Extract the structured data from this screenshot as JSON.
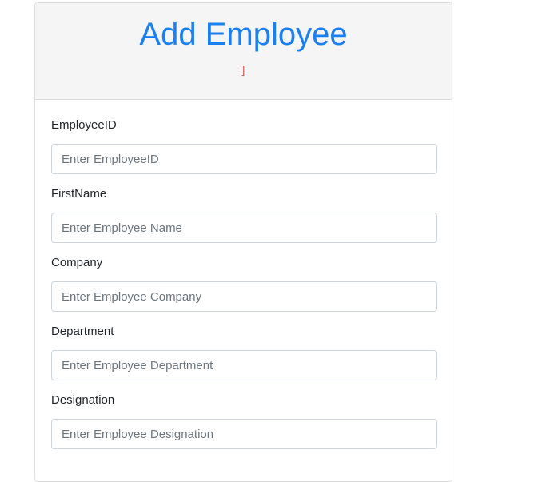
{
  "header": {
    "title": "Add Employee",
    "error_text": "]"
  },
  "form": {
    "fields": [
      {
        "label": "EmployeeID",
        "placeholder": "Enter EmployeeID",
        "value": ""
      },
      {
        "label": "FirstName",
        "placeholder": "Enter Employee Name",
        "value": ""
      },
      {
        "label": "Company",
        "placeholder": "Enter Employee Company",
        "value": ""
      },
      {
        "label": "Department",
        "placeholder": "Enter Employee Department",
        "value": ""
      },
      {
        "label": "Designation",
        "placeholder": "Enter Employee Designation",
        "value": ""
      }
    ]
  },
  "colors": {
    "title": "#1a7ff0",
    "header_bg": "#f5f5f5",
    "error": "#d9534f",
    "border": "#ced4da"
  }
}
